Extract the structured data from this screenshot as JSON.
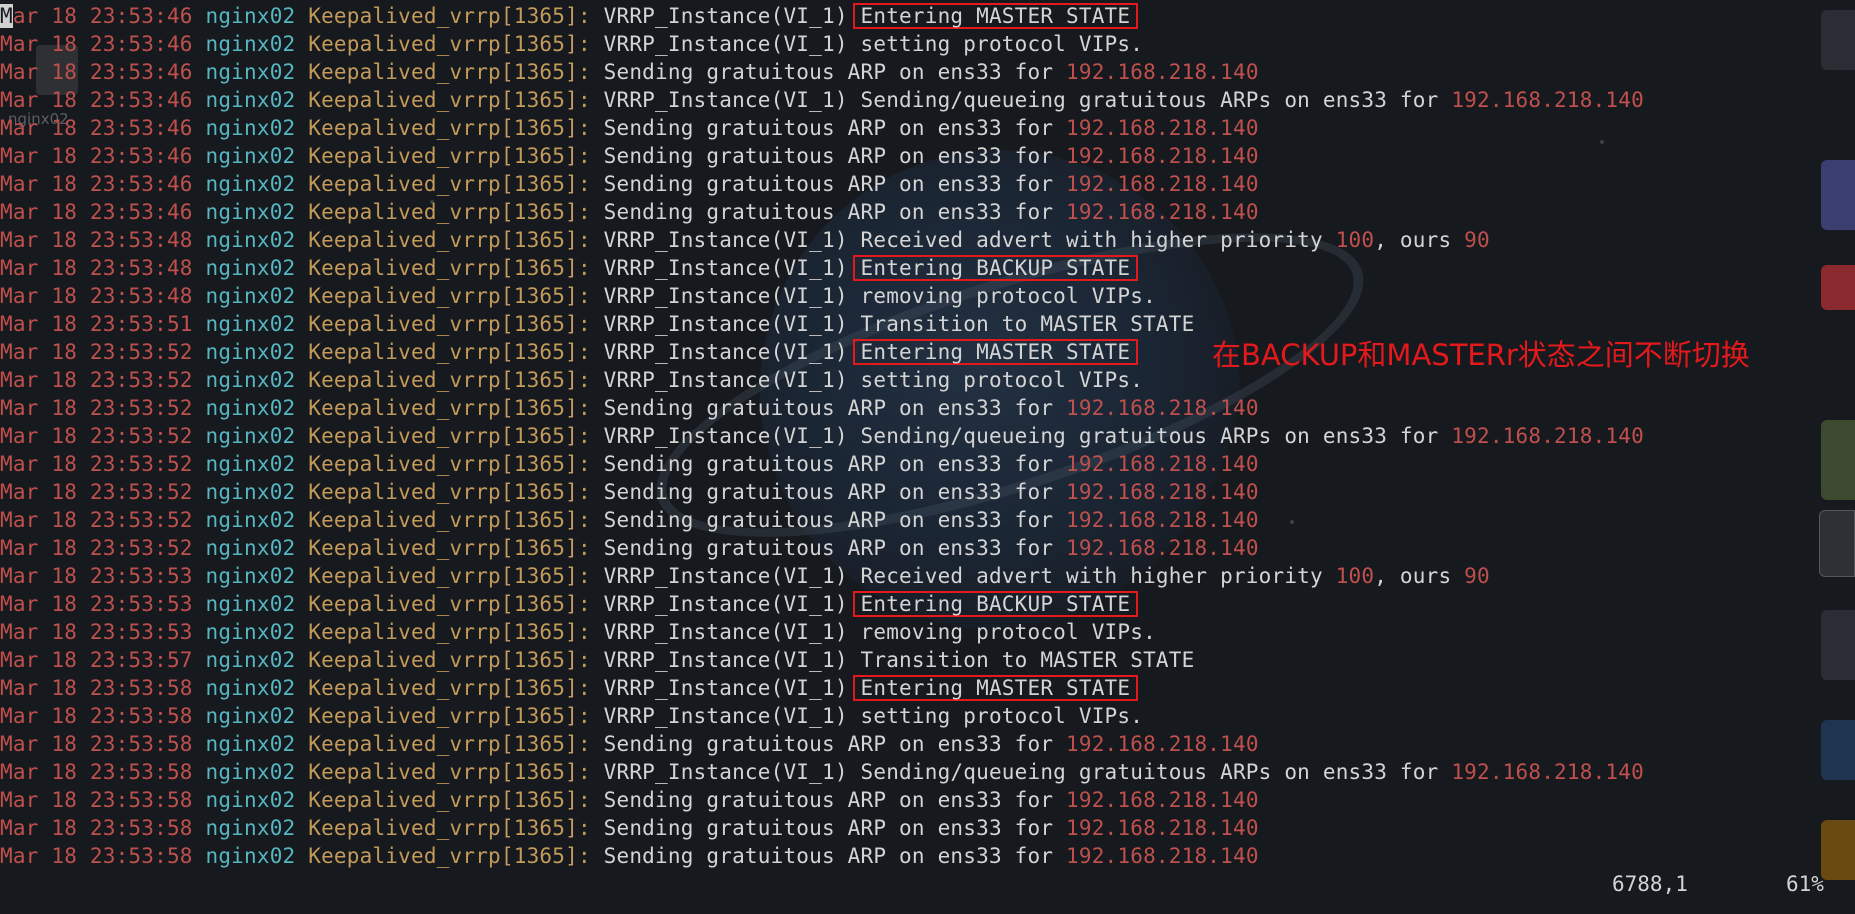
{
  "terminal": {
    "ghost_label": "nginx02",
    "annotation": "在BACKUP和MASTERr状态之间不断切换",
    "status": {
      "position": "6788,1",
      "scroll": "61%"
    },
    "lines": [
      {
        "date": "Mar 18 23:53:46",
        "host": "nginx02",
        "proc": "Keepalived_vrrp[1365]:",
        "msg": "VRRP_Instance(VI_1) ",
        "hl": "Entering MASTER STATE",
        "ip": ""
      },
      {
        "date": "Mar 18 23:53:46",
        "host": "nginx02",
        "proc": "Keepalived_vrrp[1365]:",
        "msg": "VRRP_Instance(VI_1) setting protocol VIPs.",
        "hl": "",
        "ip": ""
      },
      {
        "date": "Mar 18 23:53:46",
        "host": "nginx02",
        "proc": "Keepalived_vrrp[1365]:",
        "msg": "Sending gratuitous ARP on ens33 for ",
        "hl": "",
        "ip": "192.168.218.140"
      },
      {
        "date": "Mar 18 23:53:46",
        "host": "nginx02",
        "proc": "Keepalived_vrrp[1365]:",
        "msg": "VRRP_Instance(VI_1) Sending/queueing gratuitous ARPs on ens33 for ",
        "hl": "",
        "ip": "192.168.218.140"
      },
      {
        "date": "Mar 18 23:53:46",
        "host": "nginx02",
        "proc": "Keepalived_vrrp[1365]:",
        "msg": "Sending gratuitous ARP on ens33 for ",
        "hl": "",
        "ip": "192.168.218.140"
      },
      {
        "date": "Mar 18 23:53:46",
        "host": "nginx02",
        "proc": "Keepalived_vrrp[1365]:",
        "msg": "Sending gratuitous ARP on ens33 for ",
        "hl": "",
        "ip": "192.168.218.140"
      },
      {
        "date": "Mar 18 23:53:46",
        "host": "nginx02",
        "proc": "Keepalived_vrrp[1365]:",
        "msg": "Sending gratuitous ARP on ens33 for ",
        "hl": "",
        "ip": "192.168.218.140"
      },
      {
        "date": "Mar 18 23:53:46",
        "host": "nginx02",
        "proc": "Keepalived_vrrp[1365]:",
        "msg": "Sending gratuitous ARP on ens33 for ",
        "hl": "",
        "ip": "192.168.218.140"
      },
      {
        "date": "Mar 18 23:53:48",
        "host": "nginx02",
        "proc": "Keepalived_vrrp[1365]:",
        "msg": "VRRP_Instance(VI_1) Received advert with higher priority ",
        "hl": "",
        "ip": "",
        "prio": "100",
        "mid": ", ours ",
        "ours": "90"
      },
      {
        "date": "Mar 18 23:53:48",
        "host": "nginx02",
        "proc": "Keepalived_vrrp[1365]:",
        "msg": "VRRP_Instance(VI_1) ",
        "hl": "Entering BACKUP STATE",
        "ip": ""
      },
      {
        "date": "Mar 18 23:53:48",
        "host": "nginx02",
        "proc": "Keepalived_vrrp[1365]:",
        "msg": "VRRP_Instance(VI_1) removing protocol VIPs.",
        "hl": "",
        "ip": ""
      },
      {
        "date": "Mar 18 23:53:51",
        "host": "nginx02",
        "proc": "Keepalived_vrrp[1365]:",
        "msg": "VRRP_Instance(VI_1) Transition to MASTER STATE",
        "hl": "",
        "ip": ""
      },
      {
        "date": "Mar 18 23:53:52",
        "host": "nginx02",
        "proc": "Keepalived_vrrp[1365]:",
        "msg": "VRRP_Instance(VI_1) ",
        "hl": "Entering MASTER STATE",
        "ip": ""
      },
      {
        "date": "Mar 18 23:53:52",
        "host": "nginx02",
        "proc": "Keepalived_vrrp[1365]:",
        "msg": "VRRP_Instance(VI_1) setting protocol VIPs.",
        "hl": "",
        "ip": ""
      },
      {
        "date": "Mar 18 23:53:52",
        "host": "nginx02",
        "proc": "Keepalived_vrrp[1365]:",
        "msg": "Sending gratuitous ARP on ens33 for ",
        "hl": "",
        "ip": "192.168.218.140"
      },
      {
        "date": "Mar 18 23:53:52",
        "host": "nginx02",
        "proc": "Keepalived_vrrp[1365]:",
        "msg": "VRRP_Instance(VI_1) Sending/queueing gratuitous ARPs on ens33 for ",
        "hl": "",
        "ip": "192.168.218.140"
      },
      {
        "date": "Mar 18 23:53:52",
        "host": "nginx02",
        "proc": "Keepalived_vrrp[1365]:",
        "msg": "Sending gratuitous ARP on ens33 for ",
        "hl": "",
        "ip": "192.168.218.140"
      },
      {
        "date": "Mar 18 23:53:52",
        "host": "nginx02",
        "proc": "Keepalived_vrrp[1365]:",
        "msg": "Sending gratuitous ARP on ens33 for ",
        "hl": "",
        "ip": "192.168.218.140"
      },
      {
        "date": "Mar 18 23:53:52",
        "host": "nginx02",
        "proc": "Keepalived_vrrp[1365]:",
        "msg": "Sending gratuitous ARP on ens33 for ",
        "hl": "",
        "ip": "192.168.218.140"
      },
      {
        "date": "Mar 18 23:53:52",
        "host": "nginx02",
        "proc": "Keepalived_vrrp[1365]:",
        "msg": "Sending gratuitous ARP on ens33 for ",
        "hl": "",
        "ip": "192.168.218.140"
      },
      {
        "date": "Mar 18 23:53:53",
        "host": "nginx02",
        "proc": "Keepalived_vrrp[1365]:",
        "msg": "VRRP_Instance(VI_1) Received advert with higher priority ",
        "hl": "",
        "ip": "",
        "prio": "100",
        "mid": ", ours ",
        "ours": "90"
      },
      {
        "date": "Mar 18 23:53:53",
        "host": "nginx02",
        "proc": "Keepalived_vrrp[1365]:",
        "msg": "VRRP_Instance(VI_1) ",
        "hl": "Entering BACKUP STATE",
        "ip": ""
      },
      {
        "date": "Mar 18 23:53:53",
        "host": "nginx02",
        "proc": "Keepalived_vrrp[1365]:",
        "msg": "VRRP_Instance(VI_1) removing protocol VIPs.",
        "hl": "",
        "ip": ""
      },
      {
        "date": "Mar 18 23:53:57",
        "host": "nginx02",
        "proc": "Keepalived_vrrp[1365]:",
        "msg": "VRRP_Instance(VI_1) Transition to MASTER STATE",
        "hl": "",
        "ip": ""
      },
      {
        "date": "Mar 18 23:53:58",
        "host": "nginx02",
        "proc": "Keepalived_vrrp[1365]:",
        "msg": "VRRP_Instance(VI_1) ",
        "hl": "Entering MASTER STATE",
        "ip": ""
      },
      {
        "date": "Mar 18 23:53:58",
        "host": "nginx02",
        "proc": "Keepalived_vrrp[1365]:",
        "msg": "VRRP_Instance(VI_1) setting protocol VIPs.",
        "hl": "",
        "ip": ""
      },
      {
        "date": "Mar 18 23:53:58",
        "host": "nginx02",
        "proc": "Keepalived_vrrp[1365]:",
        "msg": "Sending gratuitous ARP on ens33 for ",
        "hl": "",
        "ip": "192.168.218.140"
      },
      {
        "date": "Mar 18 23:53:58",
        "host": "nginx02",
        "proc": "Keepalived_vrrp[1365]:",
        "msg": "VRRP_Instance(VI_1) Sending/queueing gratuitous ARPs on ens33 for ",
        "hl": "",
        "ip": "192.168.218.140"
      },
      {
        "date": "Mar 18 23:53:58",
        "host": "nginx02",
        "proc": "Keepalived_vrrp[1365]:",
        "msg": "Sending gratuitous ARP on ens33 for ",
        "hl": "",
        "ip": "192.168.218.140"
      },
      {
        "date": "Mar 18 23:53:58",
        "host": "nginx02",
        "proc": "Keepalived_vrrp[1365]:",
        "msg": "Sending gratuitous ARP on ens33 for ",
        "hl": "",
        "ip": "192.168.218.140"
      },
      {
        "date": "Mar 18 23:53:58",
        "host": "nginx02",
        "proc": "Keepalived_vrrp[1365]:",
        "msg": "Sending gratuitous ARP on ens33 for ",
        "hl": "",
        "ip": "192.168.218.140"
      }
    ]
  }
}
